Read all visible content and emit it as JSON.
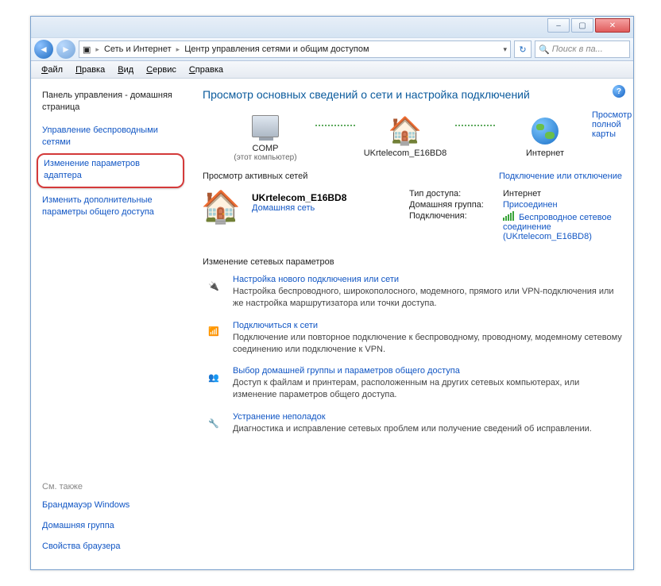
{
  "titlebar": {
    "min": "–",
    "max": "▢",
    "close": "✕"
  },
  "address": {
    "crumb1": "Сеть и Интернет",
    "crumb2": "Центр управления сетями и общим доступом",
    "search_placeholder": "Поиск в па..."
  },
  "menu": [
    "Файл",
    "Правка",
    "Вид",
    "Сервис",
    "Справка"
  ],
  "sidebar": {
    "control_panel_home": "Панель управления - домашняя страница",
    "items": [
      "Управление беспроводными сетями",
      "Изменение параметров адаптера",
      "Изменить дополнительные параметры общего доступа"
    ],
    "see_also_header": "См. также",
    "see_also": [
      "Брандмауэр Windows",
      "Домашняя группа",
      "Свойства браузера"
    ]
  },
  "main": {
    "title": "Просмотр основных сведений о сети и настройка подключений",
    "map_full": "Просмотр полной карты",
    "nodes": {
      "pc": "COMP",
      "pc_sub": "(этот компьютер)",
      "router": "UKrtelecom_E16BD8",
      "internet": "Интернет"
    },
    "active_header": "Просмотр активных сетей",
    "connect_disconnect": "Подключение или отключение",
    "network": {
      "name": "UKrtelecom_E16BD8",
      "type": "Домашняя сеть"
    },
    "props": {
      "access_k": "Тип доступа:",
      "access_v": "Интернет",
      "homegroup_k": "Домашняя группа:",
      "homegroup_v": "Присоединен",
      "conn_k": "Подключения:",
      "conn_v": "Беспроводное сетевое соединение (UKrtelecom_E16BD8)"
    },
    "change_header": "Изменение сетевых параметров",
    "tasks": [
      {
        "title": "Настройка нового подключения или сети",
        "desc": "Настройка беспроводного, широкополосного, модемного, прямого или VPN-подключения или же настройка маршрутизатора или точки доступа."
      },
      {
        "title": "Подключиться к сети",
        "desc": "Подключение или повторное подключение к беспроводному, проводному, модемному сетевому соединению или подключение к VPN."
      },
      {
        "title": "Выбор домашней группы и параметров общего доступа",
        "desc": "Доступ к файлам и принтерам, расположенным на других сетевых компьютерах, или изменение параметров общего доступа."
      },
      {
        "title": "Устранение неполадок",
        "desc": "Диагностика и исправление сетевых проблем или получение сведений об исправлении."
      }
    ]
  }
}
